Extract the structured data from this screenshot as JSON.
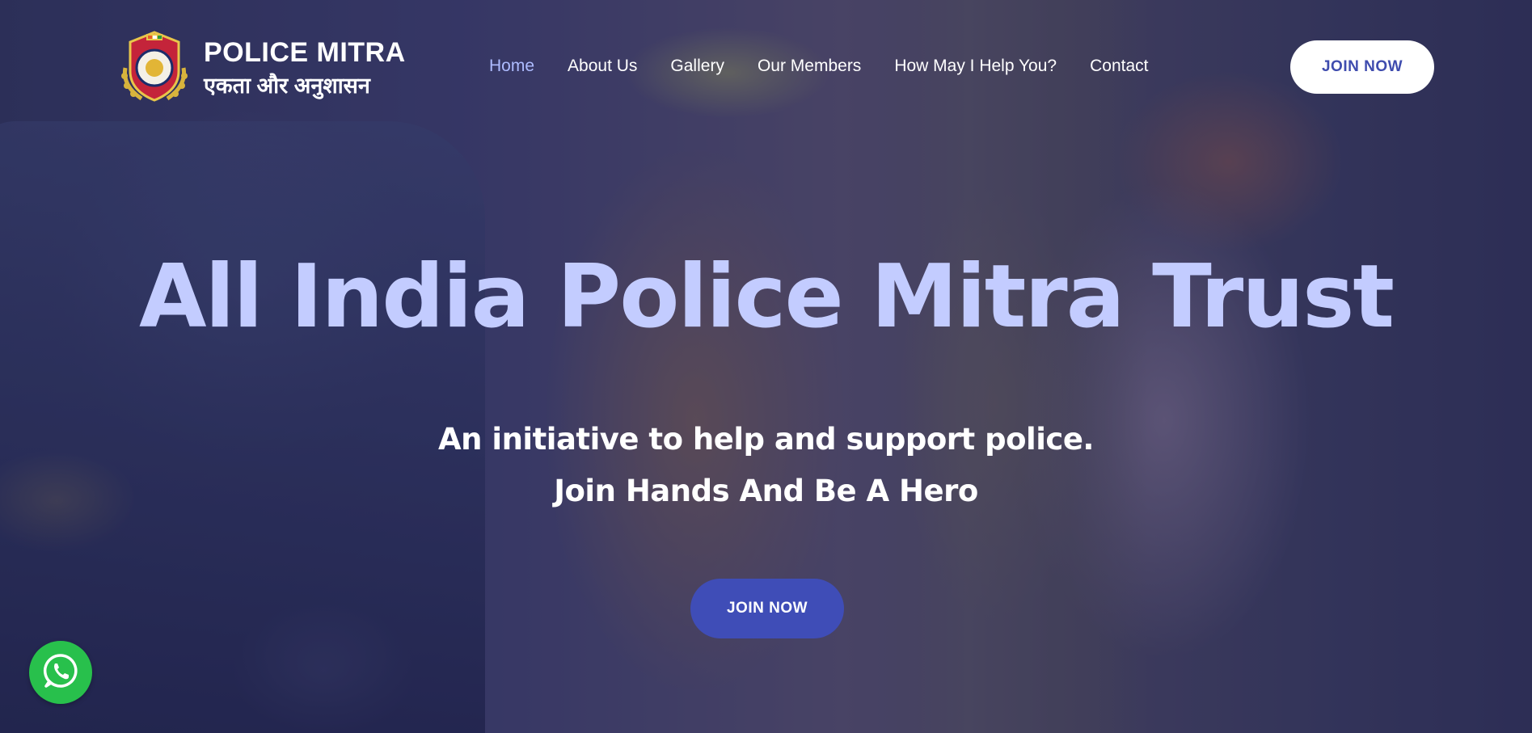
{
  "brand": {
    "title": "POLICE MITRA",
    "tagline": "एकता और अनुशासन",
    "logo_icon": "police-badge-emblem"
  },
  "nav": {
    "items": [
      {
        "label": "Home",
        "active": true
      },
      {
        "label": "About Us",
        "active": false
      },
      {
        "label": "Gallery",
        "active": false
      },
      {
        "label": "Our Members",
        "active": false
      },
      {
        "label": "How May I Help You?",
        "active": false
      },
      {
        "label": "Contact",
        "active": false
      }
    ],
    "cta_label": "JOIN NOW"
  },
  "hero": {
    "title": "All India Police Mitra Trust",
    "subtitle_1": "An initiative to help and support police.",
    "subtitle_2": "Join Hands And Be A Hero",
    "cta_label": "JOIN NOW"
  },
  "floating": {
    "whatsapp_icon": "whatsapp-icon"
  },
  "colors": {
    "accent": "#3f4db7",
    "title_tint": "#c3ccff",
    "nav_active": "#aebcff",
    "whatsapp": "#28c04c"
  }
}
